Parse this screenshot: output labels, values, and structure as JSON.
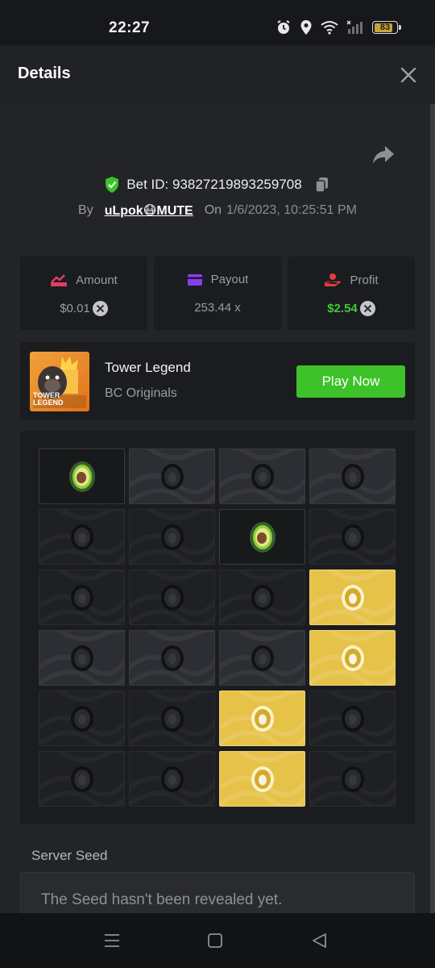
{
  "status": {
    "time": "22:27",
    "battery": "83",
    "battery_level": 0.83,
    "icons": [
      "alarm-icon",
      "location-icon",
      "wifi-icon",
      "signal-icon",
      "battery-icon"
    ]
  },
  "header": {
    "title": "Details",
    "close_icon": "close-icon"
  },
  "bet": {
    "id_text": "Bet ID: 93827219893259708",
    "by_label": "By",
    "username": "uLpok😷MUTE",
    "on_label": "On",
    "date": "1/6/2023, 10:25:51 PM"
  },
  "stats": [
    {
      "label": "Amount",
      "value": "$0.01",
      "icon": "amount-icon",
      "color": "#e23d66"
    },
    {
      "label": "Payout",
      "value": "253.44 x",
      "icon": "payout-card-icon",
      "color": "#8a3df0"
    },
    {
      "label": "Profit",
      "value": "$2.54",
      "icon": "profit-hand-icon",
      "color": "#e23b3b"
    }
  ],
  "game": {
    "name": "Tower Legend",
    "provider": "BC Originals",
    "thumb_text": "TOWER LEGEND",
    "play_label": "Play Now"
  },
  "board": {
    "rows": [
      [
        "avocado",
        "lit",
        "lit",
        "lit"
      ],
      [
        "dim",
        "dim",
        "avocado",
        "dim"
      ],
      [
        "dim",
        "dim",
        "dim",
        "gold"
      ],
      [
        "lit",
        "lit",
        "lit",
        "gold"
      ],
      [
        "dim",
        "dim",
        "gold",
        "dim"
      ],
      [
        "dim",
        "dim",
        "gold",
        "dim"
      ]
    ]
  },
  "server_seed": {
    "label": "Server Seed",
    "value": "The Seed hasn't been revealed yet."
  },
  "colors": {
    "accent_green": "#3dc22a",
    "gold_tile": "#e6c248",
    "background": "#232427"
  }
}
